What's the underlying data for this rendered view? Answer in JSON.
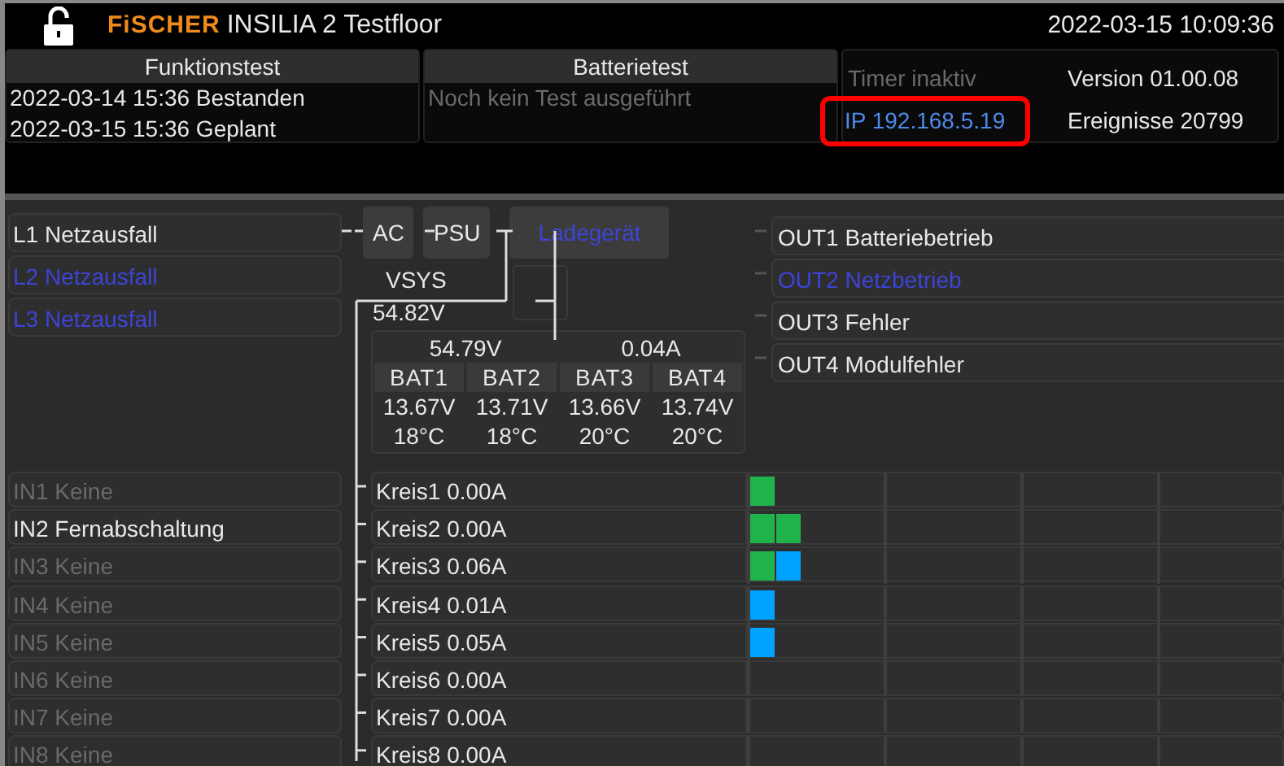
{
  "header": {
    "brand": "FiSCHER",
    "title": "INSILIA 2 Testfloor",
    "clock": "2022-03-15 10:09:36",
    "locked": false
  },
  "function_test": {
    "title": "Funktionstest",
    "lines": [
      "2022-03-14 15:36 Bestanden",
      "2022-03-15 15:36 Geplant"
    ]
  },
  "battery_test": {
    "title": "Batterietest",
    "message": "Noch kein Test ausgeführt"
  },
  "info": {
    "timer": "Timer inaktiv",
    "version": "Version 01.00.08",
    "ip": "IP 192.168.5.19",
    "ip_highlighted": true,
    "events": "Ereignisse 20799"
  },
  "phases": [
    {
      "label": "L1 Netzausfall",
      "highlighted": false
    },
    {
      "label": "L2 Netzausfall",
      "highlighted": true
    },
    {
      "label": "L3 Netzausfall",
      "highlighted": true
    }
  ],
  "power_chain": [
    {
      "label": "AC",
      "highlighted": false
    },
    {
      "label": "PSU",
      "highlighted": false
    },
    {
      "label": "Ladegerät",
      "highlighted": true
    }
  ],
  "vsys": {
    "label": "VSYS",
    "voltage": "54.82V"
  },
  "battery": {
    "voltage": "54.79V",
    "current": "0.04A",
    "cells": [
      {
        "name": "BAT1",
        "voltage": "13.67V",
        "temp": "18°C"
      },
      {
        "name": "BAT2",
        "voltage": "13.71V",
        "temp": "18°C"
      },
      {
        "name": "BAT3",
        "voltage": "13.66V",
        "temp": "20°C"
      },
      {
        "name": "BAT4",
        "voltage": "13.74V",
        "temp": "20°C"
      }
    ]
  },
  "outputs": [
    {
      "label": "OUT1 Batteriebetrieb",
      "highlighted": false
    },
    {
      "label": "OUT2 Netzbetrieb",
      "highlighted": true
    },
    {
      "label": "OUT3 Fehler",
      "highlighted": false
    },
    {
      "label": "OUT4 Modulfehler",
      "highlighted": false
    }
  ],
  "inputs": [
    {
      "label": "IN1 Keine",
      "disabled": true
    },
    {
      "label": "IN2 Fernabschaltung",
      "disabled": false
    },
    {
      "label": "IN3 Keine",
      "disabled": true
    },
    {
      "label": "IN4 Keine",
      "disabled": true
    },
    {
      "label": "IN5 Keine",
      "disabled": true
    },
    {
      "label": "IN6 Keine",
      "disabled": true
    },
    {
      "label": "IN7 Keine",
      "disabled": true
    },
    {
      "label": "IN8 Keine",
      "disabled": true
    }
  ],
  "circuits": [
    {
      "label": "Kreis1 0.00A",
      "blocks": [
        {
          "color": "#21b34b"
        }
      ]
    },
    {
      "label": "Kreis2 0.00A",
      "blocks": [
        {
          "color": "#21b34b"
        },
        {
          "color": "#21b34b"
        }
      ]
    },
    {
      "label": "Kreis3 0.06A",
      "blocks": [
        {
          "color": "#21b34b"
        },
        {
          "color": "#00a2ff"
        }
      ]
    },
    {
      "label": "Kreis4 0.01A",
      "blocks": [
        {
          "color": "#00a2ff"
        }
      ]
    },
    {
      "label": "Kreis5 0.05A",
      "blocks": [
        {
          "color": "#00a2ff"
        }
      ]
    },
    {
      "label": "Kreis6 0.00A"
    },
    {
      "label": "Kreis7 0.00A"
    },
    {
      "label": "Kreis8 0.00A"
    }
  ]
}
